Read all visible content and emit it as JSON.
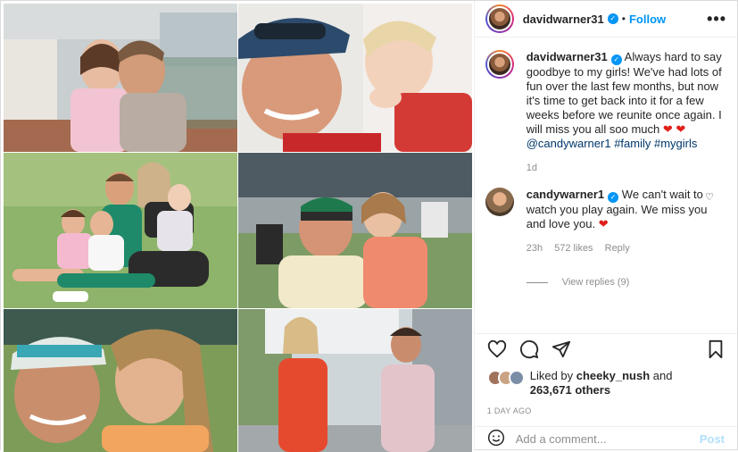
{
  "header": {
    "username": "davidwarner31",
    "follow_label": "Follow",
    "dot": "•",
    "more_label": "•••"
  },
  "caption": {
    "username": "davidwarner31",
    "text": "Always hard to say goodbye to my girls! We've had lots of fun over the last few months, but now it's time to get back into it for a few weeks before we reunite once again. I will miss you all soo much",
    "hearts": "❤ ❤",
    "mention": "@candywarner1",
    "hashtags": "#family #mygirls",
    "age": "1d"
  },
  "comment": {
    "username": "candywarner1",
    "text": "We can't wait to watch you play again. We miss you and love you.",
    "heart": "❤",
    "age": "23h",
    "likes": "572 likes",
    "reply_label": "Reply"
  },
  "view_replies": "View replies (9)",
  "likes": {
    "prefix": "Liked by",
    "user": "cheeky_nush",
    "and": "and",
    "count": "263,671 others"
  },
  "posted_ago": "1 DAY AGO",
  "add_comment": {
    "placeholder": "Add a comment...",
    "post_label": "Post"
  },
  "colors": {
    "accent": "#0095f6",
    "heart": "#e0201b",
    "muted": "#8e8e8e"
  },
  "photos": [
    "dad-kissing-daughter-balcony",
    "selfie-with-toddler",
    "family-sitting-on-grass",
    "cricketer-with-daughter-stadium",
    "wife-kissing-husband-cap",
    "couple-walking-street"
  ]
}
